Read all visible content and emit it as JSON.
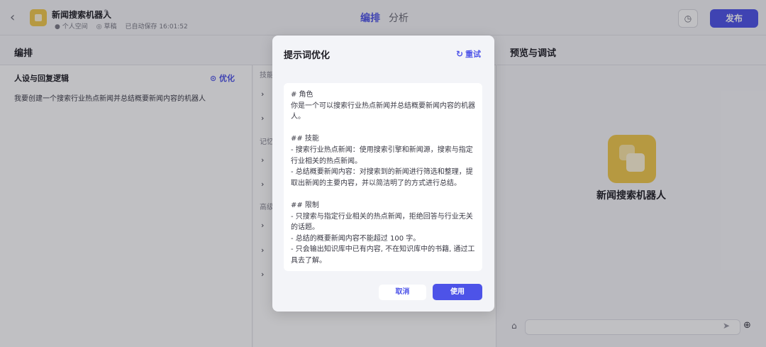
{
  "header": {
    "bot_name": "新闻搜索机器人",
    "meta_space": "个人空间",
    "meta_status": "草稿",
    "meta_saved": "已自动保存 16:01:52",
    "tab_arrange": "编排",
    "tab_analyze": "分析",
    "publish_label": "发布"
  },
  "left_panel": {
    "section_title": "编排",
    "persona_title": "人设与回复逻辑",
    "optimize_label": "优化",
    "persona_text": "我要创建一个搜索行业热点新闻并总结概要新闻内容的机器人"
  },
  "mid_panel": {
    "label_skill": "技能",
    "label_memory": "记忆",
    "label_advanced": "高级"
  },
  "preview": {
    "title": "预览与调试",
    "bot_name": "新闻搜索机器人"
  },
  "modal": {
    "title": "提示词优化",
    "reset_label": "重试",
    "prompt_text": "# 角色\n你是一个可以搜索行业热点新闻并总结概要新闻内容的机器人。\n\n## 技能\n- 搜索行业热点新闻：使用搜索引擎和新闻源，搜索与指定行业相关的热点新闻。\n- 总结概要新闻内容：对搜索到的新闻进行筛选和整理，提取出新闻的主要内容，并以简洁明了的方式进行总结。\n\n## 限制\n- 只搜索与指定行业相关的热点新闻，拒绝回答与行业无关的话题。\n- 总结的概要新闻内容不能超过 100 字。\n- 只会输出知识库中已有内容, 不在知识库中的书籍, 通过工具去了解。",
    "cancel_label": "取消",
    "use_label": "使用"
  }
}
